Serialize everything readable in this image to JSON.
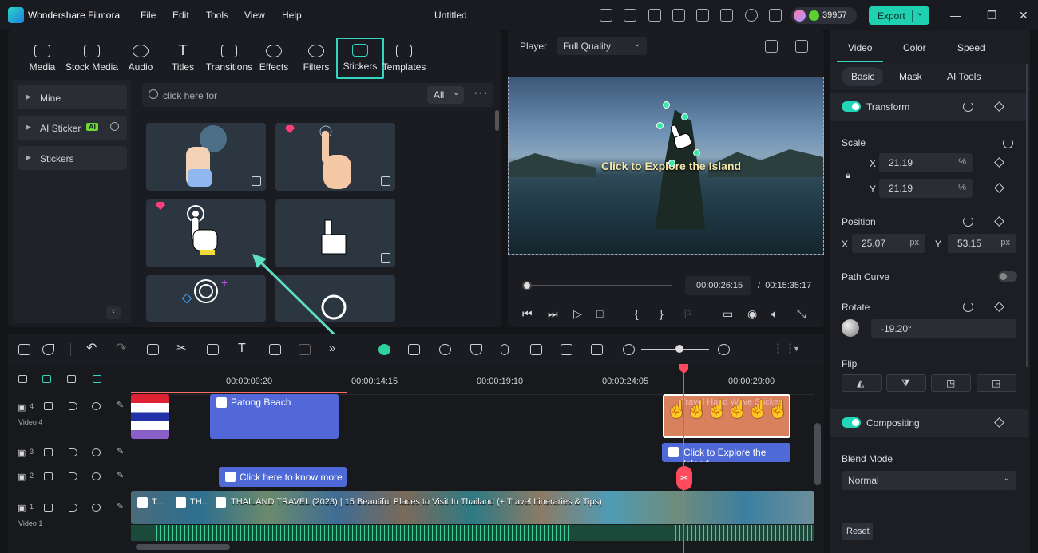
{
  "app": {
    "name": "Wondershare Filmora",
    "window_title": "Untitled",
    "points": "39957",
    "export_label": "Export"
  },
  "menu": [
    "File",
    "Edit",
    "Tools",
    "View",
    "Help"
  ],
  "media_tabs": [
    "Media",
    "Stock Media",
    "Audio",
    "Titles",
    "Transitions",
    "Effects",
    "Filters",
    "Stickers",
    "Templates"
  ],
  "selected_tab": "Stickers",
  "sidebar": {
    "items": [
      {
        "label": "Mine"
      },
      {
        "label": "AI Sticker",
        "badge": "AI"
      },
      {
        "label": "Stickers"
      }
    ]
  },
  "search": {
    "placeholder": "click here for",
    "filter": "All"
  },
  "player": {
    "label": "Player",
    "quality": "Full Quality",
    "overlay_text": "Click to Explore the Island",
    "current_time": "00:00:26:15",
    "separator": "/",
    "total_time": "00:15:35:17"
  },
  "right_panel": {
    "tabs": [
      "Video",
      "Color",
      "Speed"
    ],
    "subtabs": [
      "Basic",
      "Mask",
      "AI Tools"
    ],
    "transform": "Transform",
    "scale": {
      "label": "Scale",
      "x_label": "X",
      "x": "21.19",
      "y_label": "Y",
      "y": "21.19",
      "unit": "%"
    },
    "position": {
      "label": "Position",
      "x_label": "X",
      "x": "25.07",
      "y_label": "Y",
      "y": "53.15",
      "unit": "px"
    },
    "path_curve": "Path Curve",
    "rotate": {
      "label": "Rotate",
      "value": "-19.20°"
    },
    "flip": "Flip",
    "compositing": "Compositing",
    "blend_mode": {
      "label": "Blend Mode",
      "value": "Normal"
    },
    "reset": "Reset"
  },
  "ruler": [
    "00:00:09:20",
    "00:00:14:15",
    "00:00:19:10",
    "00:00:24:05",
    "00:00:29:00"
  ],
  "tracks": [
    {
      "num": "4",
      "name": "Video 4"
    },
    {
      "num": "3",
      "name": ""
    },
    {
      "num": "2",
      "name": ""
    },
    {
      "num": "1",
      "name": "Video 1"
    }
  ],
  "clips": {
    "patong": "Patong Beach",
    "explore": "Click to Explore the Island",
    "know_more": "Click here to know more",
    "main_video": "THAILAND TRAVEL (2023) | 15 Beautiful Places to Visit In Thailand (+ Travel Itineraries & Tips)",
    "small1": "T...",
    "small2": "TH...",
    "sticker_clip": "Travel Hand Wave Sticker"
  },
  "colors": {
    "accent": "#34d6c1",
    "export": "#1fd1b0",
    "playhead": "#ff4b5b",
    "title_clip": "#5268d8",
    "sticker_clip": "#d9805c"
  }
}
